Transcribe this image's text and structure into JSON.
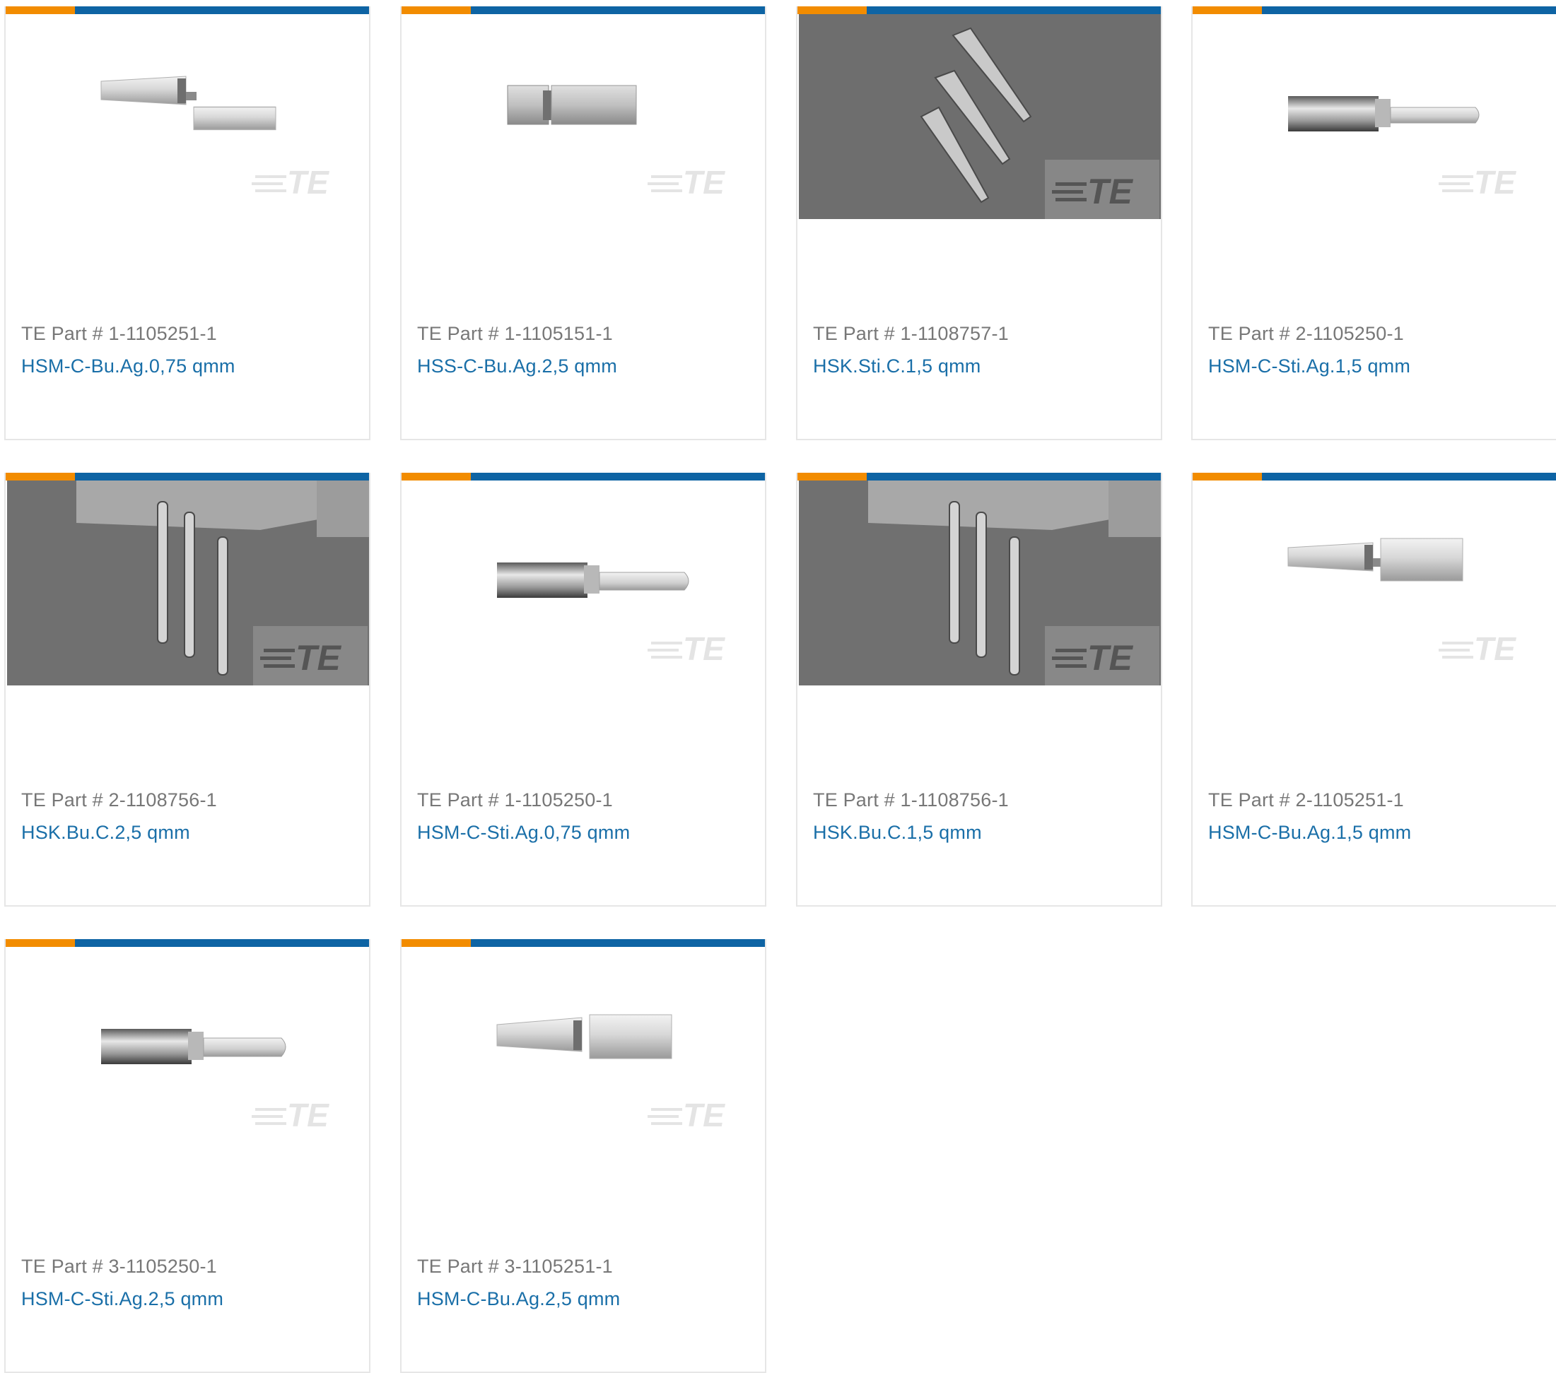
{
  "cards": [
    {
      "part_number": "TE Part # 1-1105251-1",
      "name": "HSM-C-Bu.Ag.0,75 qmm",
      "image": "socket-contact-straight-icon"
    },
    {
      "part_number": "TE Part # 1-1105151-1",
      "name": "HSS-C-Bu.Ag.2,5 qmm",
      "image": "socket-contact-short-icon"
    },
    {
      "part_number": "TE Part # 1-1108757-1",
      "name": "HSK.Sti.C.1,5 qmm",
      "image": "pin-contacts-photo"
    },
    {
      "part_number": "TE Part # 2-1105250-1",
      "name": "HSM-C-Sti.Ag.1,5 qmm",
      "image": "pin-contact-icon"
    },
    {
      "part_number": "TE Part # 2-1108756-1",
      "name": "HSK.Bu.C.2,5 qmm",
      "image": "socket-contacts-photo"
    },
    {
      "part_number": "TE Part # 1-1105250-1",
      "name": "HSM-C-Sti.Ag.0,75 qmm",
      "image": "pin-contact-icon"
    },
    {
      "part_number": "TE Part # 1-1108756-1",
      "name": "HSK.Bu.C.1,5 qmm",
      "image": "socket-contacts-photo"
    },
    {
      "part_number": "TE Part # 2-1105251-1",
      "name": "HSM-C-Bu.Ag.1,5 qmm",
      "image": "socket-contact-straight-icon"
    },
    {
      "part_number": "TE Part # 3-1105250-1",
      "name": "HSM-C-Sti.Ag.2,5 qmm",
      "image": "pin-contact-icon"
    },
    {
      "part_number": "TE Part # 3-1105251-1",
      "name": "HSM-C-Bu.Ag.2,5 qmm",
      "image": "socket-contact-straight-icon"
    }
  ],
  "watermark": "TE",
  "colors": {
    "accent_orange": "#f28c00",
    "accent_blue": "#0e64a4",
    "link": "#1a6fa8",
    "muted_text": "#777777"
  }
}
